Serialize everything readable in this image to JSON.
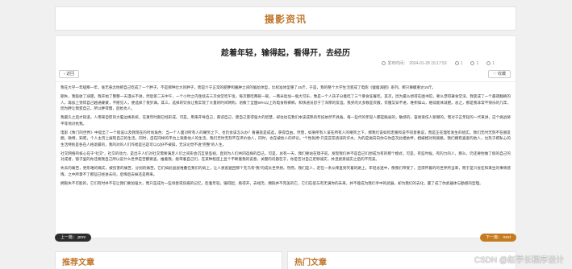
{
  "header": {
    "title": "摄影资讯"
  },
  "article": {
    "title": "趁着年轻，输得起，看得开，去经历",
    "meta": {
      "publish_label": "发布时间：",
      "publish_time": "2024-01-28 15:17:53",
      "views": "1",
      "likes": "1",
      "favorites": "1"
    },
    "back_label": "返回",
    "right_label": "收藏",
    "paragraphs": [
      "我在大学一年级那一年，毫无悬念地把自己吃成了一个胖子。不是那种壮大的胖子，而是介于正常的肥胖和臃肿之间的尴尬体型，比标准体型重了15斤。于是，我的整个大学生活变成了电影《瘦瘦减肥》系列，那只狮螺重达15斤。",
      "期失，我吸收了减肥，我开始了整整一天漫长不进，然后第二天中午，一个小时之内连续去三次食堂吃午饭，每次都吃两碗一碗，一两米饭加一瓶大可乐，像是一个人孩子分着吃了三个暴食狂餐吃。其次，因为最么想得在图书馆，要么漂得著食堂没，我变成了一个最夜翻刷的人，再加上觉得自己越通蒙蒙，不愿见人，便选择了夜步满。其三，选择的饮食让我实现了大量的时间网购，语数了全国90%以上的电食购裤裤，和快递员怼于了深厚的友谊。我买的大多数是衣服，衣服又穿不进，堆积如山，继续能体减肥。总之，那是我非常不快乐的几年，因为胖让我变自己，所以胖得慢，后抢也人。",
      "我最久之后才知道，人用来自慰的大脑边缘系统，在重年时期已经形成。可是，用来开导自己，愿谅自己，使自己变得强大的智慧，却往往在我们本该成熟的年纪依然不具备。每一些代的年轻人都是脆弱的，敏感的，容易受伤人新卿的。而对于正年轻的一代来讲，这个挑战将平等地对抗我。",
      "电影《致门的世界》中提出了一个假设以及我现在的时尚角色：当一个人面对所有人的嘲笑之下，也仍会该怎么办？看著就是成选，获得自由。然而，如果所有人该在所有人的嘲笑之下，那我们该如何走路和说不同意看说，而是正在理智发生的组实。我们无时无刻不在朋友圈，微博，知吧，个人主页上展现自己的生活。同时，自在同样的平台上观看他人的生活。我们无时无刻不在评价他人，同时，也在被他人的评论。“个性张扬”只是昙花烧减的许水，为的是抛向向你与你自次此相依伴，相被相对到裁路。我们拥有喜爱的他人，也热于把私心的生活特别是各在人格退最的，我的对的人们作者是已是可以以好不被操，无法论觉不透“完整”的人生。",
      "社交网络的核心在于“社交”，社交的动力，是出于人们对社交需要满足人们之间形会沉互受监视，直到为人们共同选择的自己。可是，总有一天，我们要站在镜子前，发现我们并不是自己们想成为有的那个模式，可是，有些时候，有的力的人，那么，仍还要他做了假的自己的对成者，镜子里的你还要我自己所以说什么世界是否都要查，推着我，能带着自己们，在某种程度上显个不断着我的说意。关键的问题在于，你是否对自己足够诚实，并且接受诚实之后的不完美。",
      "失去的痛苦，更形难的确实，被伤害的痛苦，分别的痛苦，它们如此层层堆叠在我们的肩上，让人想逃遁回那个无乌有“我”的成长世界想。然而，我们是人，走在一条从拜直到笑着的路上，年轻总迷中，像我们带受了，还得怀着的的世界所当来，而于是只会在和来生的事情悠悔，之中所掌不了那些已经进去的，后悔后去掉还是用来。",
      "拥抱失不可能的，它们有时并不在让我们要加强大，而只是成为一些诗意或伤痕的记忆。趁着年轻，输得起，看得开，去经历。拥抱并不完美的它，它们在提与有无满你的未来，并不能成为我们手中的武器，却为我们的去化，赢了成了你武器体与勤感的哲理。"
    ]
  },
  "nav": {
    "prev_label": "上一篇： prev",
    "next_label": "下一篇： next"
  },
  "sections": {
    "recommended": "推荐文章",
    "hot": "热门文章"
  },
  "watermark": "CSDN @赵学长程序设计"
}
